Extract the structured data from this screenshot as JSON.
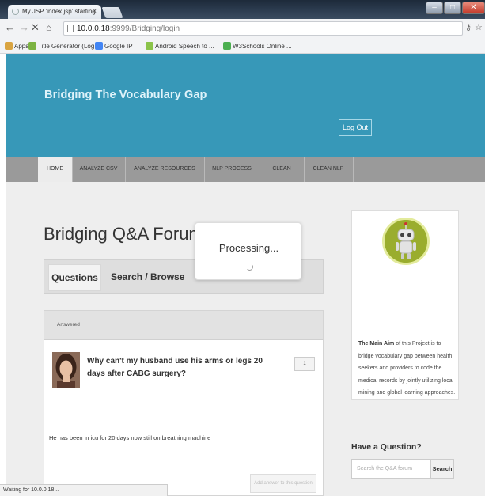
{
  "browser": {
    "tab_title": "My JSP 'index.jsp' starting",
    "tab_close": "×",
    "url_host": "10.0.0.18",
    "url_path": ":9999/Bridging/login",
    "bookmarks": [
      {
        "label": "Apps",
        "color": "#d9a441"
      },
      {
        "label": "Title Generator (Log...",
        "color": "#7cb342"
      },
      {
        "label": "Google IP",
        "color": "#4285f4"
      },
      {
        "label": "Android Speech to ...",
        "color": "#8bc34a"
      },
      {
        "label": "W3Schools Online ...",
        "color": "#4caf50"
      }
    ],
    "status": "Waiting for 10.0.0.18..."
  },
  "header": {
    "site_title": "Bridging The Vocabulary Gap",
    "logout_label": "Log Out",
    "banner_color": "#3798b8"
  },
  "nav": {
    "items": [
      "HOME",
      "ANALYZE CSV",
      "ANALYZE RESOURCES",
      "NLP PROCESS",
      "CLEAN",
      "CLEAN NLP"
    ],
    "active": "HOME"
  },
  "main": {
    "forum_title": "Bridging Q&A Forum",
    "tabs": [
      "Questions",
      "Search / Browse"
    ],
    "question": {
      "status": "Answered",
      "title": "Why can't my husband use his arms or legs 20 days after CABG surgery?",
      "votes": "1",
      "body": "He has been in icu for 20 days now still on breathing machine",
      "answer_button": "Add answer to this question"
    }
  },
  "sidebar": {
    "aim_bold": "The Main Aim",
    "aim_text": " of this Project is to bridge vocabulary gap between health seekers and providers to code the medical records by jointly utilizing local mining and global learning approaches.",
    "have_question": "Have a Question?",
    "search_placeholder": "Search the Q&A forum",
    "search_button": "Search"
  },
  "overlay": {
    "processing_text": "Processing..."
  }
}
